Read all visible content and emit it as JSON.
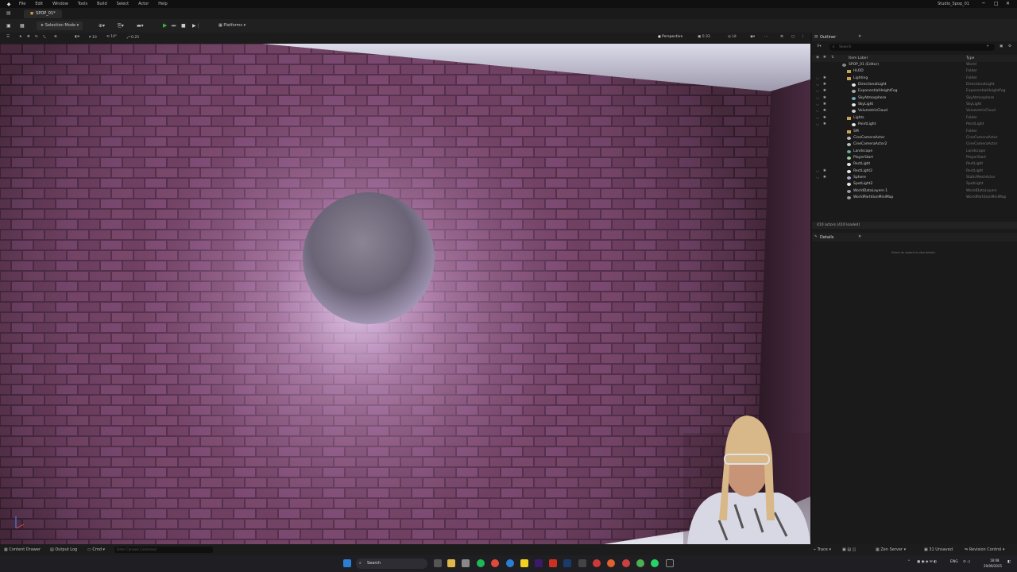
{
  "window": {
    "title": "Studio_Spop_01"
  },
  "menu": [
    "File",
    "Edit",
    "Window",
    "Tools",
    "Build",
    "Select",
    "Actor",
    "Help"
  ],
  "tab": {
    "label": "SPOP_01*"
  },
  "toolbar": {
    "mode": "Selection Mode",
    "platforms": "Platforms"
  },
  "viewport_toolbar": {
    "snap_rot": "10°",
    "snap_grid": "10",
    "snap_scale": "0.25",
    "camera_speed": "0.33",
    "view": "Perspective",
    "lit": "Lit"
  },
  "outliner": {
    "title": "Outliner",
    "search_placeholder": "Search",
    "col_label": "Item Label",
    "col_type": "Type",
    "rows": [
      {
        "name": "SPOP_01 (Editor)",
        "type": "World",
        "indent": 0,
        "vis": false,
        "icon": "world"
      },
      {
        "name": "HLOD",
        "type": "Folder",
        "indent": 1,
        "vis": false,
        "icon": "folder"
      },
      {
        "name": "Lighting",
        "type": "Folder",
        "indent": 1,
        "vis": true,
        "icon": "folder"
      },
      {
        "name": "DirectionalLight",
        "type": "DirectionalLight",
        "indent": 2,
        "vis": true,
        "icon": "light"
      },
      {
        "name": "ExponentialHeightFog",
        "type": "ExponentialHeightFog",
        "indent": 2,
        "vis": true,
        "icon": "fog"
      },
      {
        "name": "SkyAtmosphere",
        "type": "SkyAtmosphere",
        "indent": 2,
        "vis": true,
        "icon": "sky"
      },
      {
        "name": "SkyLight",
        "type": "SkyLight",
        "indent": 2,
        "vis": true,
        "icon": "light"
      },
      {
        "name": "VolumetricCloud",
        "type": "VolumetricCloud",
        "indent": 2,
        "vis": true,
        "icon": "cloud"
      },
      {
        "name": "Lights",
        "type": "Folder",
        "indent": 1,
        "vis": true,
        "icon": "folder"
      },
      {
        "name": "PointLight",
        "type": "PointLight",
        "indent": 2,
        "vis": true,
        "icon": "light"
      },
      {
        "name": "SM",
        "type": "Folder",
        "indent": 1,
        "vis": false,
        "icon": "folder"
      },
      {
        "name": "CineCameraActor",
        "type": "CineCameraActor",
        "indent": 1,
        "vis": false,
        "icon": "camera"
      },
      {
        "name": "CineCameraActor2",
        "type": "CineCameraActor",
        "indent": 1,
        "vis": false,
        "icon": "camera"
      },
      {
        "name": "Landscape",
        "type": "Landscape",
        "indent": 1,
        "vis": false,
        "icon": "landscape"
      },
      {
        "name": "PlayerStart",
        "type": "PlayerStart",
        "indent": 1,
        "vis": false,
        "icon": "player"
      },
      {
        "name": "RectLight",
        "type": "RectLight",
        "indent": 1,
        "vis": false,
        "icon": "light"
      },
      {
        "name": "RectLight2",
        "type": "RectLight",
        "indent": 1,
        "vis": true,
        "icon": "light"
      },
      {
        "name": "Sphere",
        "type": "StaticMeshActor",
        "indent": 1,
        "vis": true,
        "icon": "mesh"
      },
      {
        "name": "SpotLight2",
        "type": "SpotLight",
        "indent": 1,
        "vis": false,
        "icon": "light"
      },
      {
        "name": "WorldDataLayers-1",
        "type": "WorldDataLayers",
        "indent": 1,
        "vis": false,
        "icon": "layers"
      },
      {
        "name": "WorldPartitionMiniMap",
        "type": "WorldPartitionMiniMap",
        "indent": 1,
        "vis": false,
        "icon": "map"
      }
    ],
    "footer": "410 actors (410 loaded)"
  },
  "details": {
    "title": "Details",
    "empty_text": "Select an object to view details."
  },
  "statusbar": {
    "content_drawer": "Content Drawer",
    "output_log": "Output Log",
    "cmd": "Cmd",
    "console_placeholder": "Enter Console Command",
    "trace": "Trace",
    "server": "Zen Server",
    "unsaved": "31 Unsaved",
    "revision": "Revision Control"
  },
  "taskbar": {
    "search": "Search",
    "lang": "ENG",
    "time": "18:08",
    "date": "29/09/2025"
  },
  "colors": {
    "accent": "#2a7fd4",
    "folder": "#c9a153",
    "play": "#3cb043",
    "panel_bg": "#1a1a1a"
  }
}
